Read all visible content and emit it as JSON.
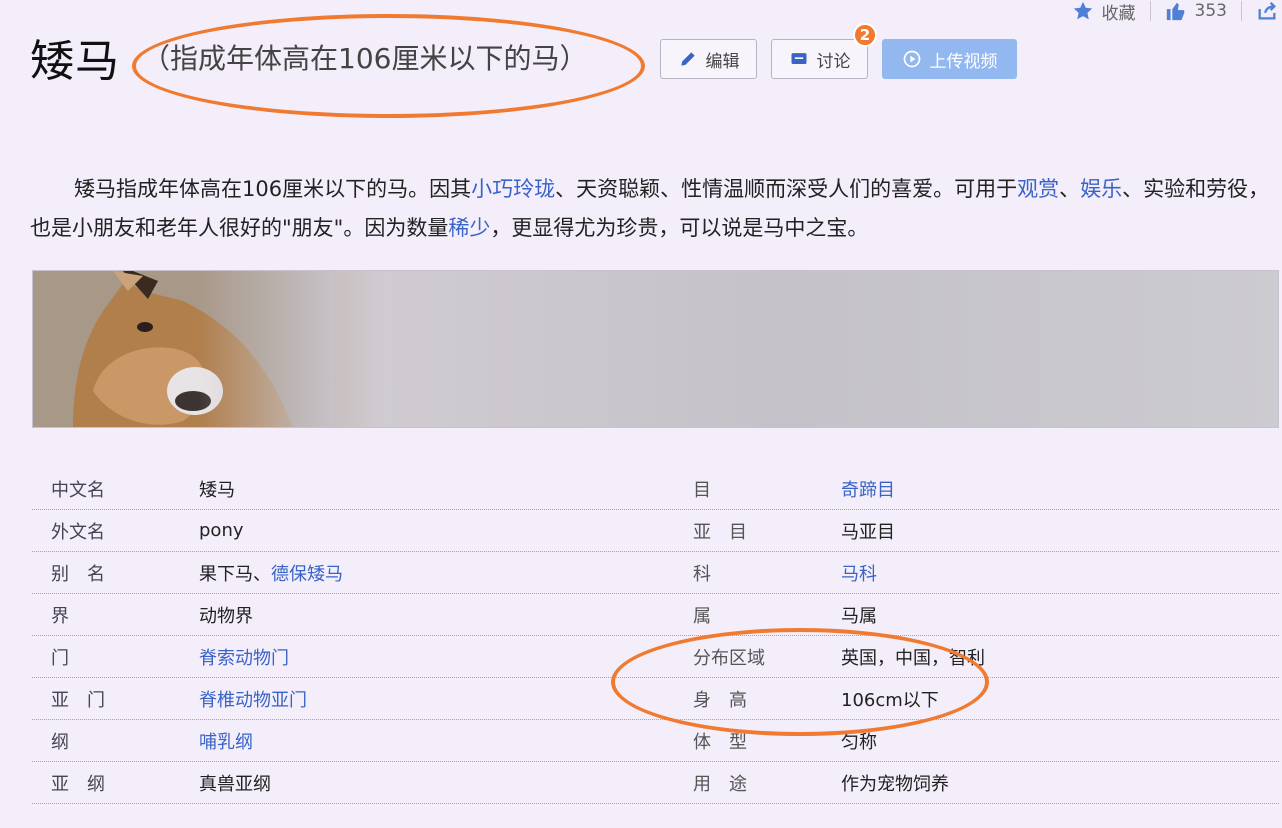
{
  "topbar": {
    "favorite_label": "收藏",
    "like_count": "353"
  },
  "title": {
    "main": "矮马",
    "subtitle": "（指成年体高在106厘米以下的马）"
  },
  "buttons": {
    "edit": "编辑",
    "discuss": "讨论",
    "discuss_badge": "2",
    "upload": "上传视频"
  },
  "intro": {
    "p1": "矮马指成年体高在106厘米以下的马。因其",
    "link_small": "小巧玲珑",
    "p2": "、天资聪颖、性情温顺而深受人们的喜爱。可用于",
    "link_view": "观赏",
    "p3": "、",
    "link_ent": "娱乐",
    "p4": "、实验和劳役，也是小朋友和老年人很好的\"朋友\"。因为数量",
    "link_rare": "稀少",
    "p5": "，更显得尤为珍贵，可以说是马中之宝。"
  },
  "info_left": [
    {
      "key": "中文名",
      "value": "矮马"
    },
    {
      "key": "外文名",
      "value": "pony"
    },
    {
      "key": "别　名",
      "value": "果下马、",
      "link": "德保矮马"
    },
    {
      "key": "界",
      "value": "动物界"
    },
    {
      "key": "门",
      "link": "脊索动物门"
    },
    {
      "key": "亚　门",
      "link": "脊椎动物亚门"
    },
    {
      "key": "纲",
      "link": "哺乳纲"
    },
    {
      "key": "亚　纲",
      "value": "真兽亚纲"
    }
  ],
  "info_right": [
    {
      "key": "目",
      "link": "奇蹄目"
    },
    {
      "key": "亚　目",
      "value": "马亚目"
    },
    {
      "key": "科",
      "link": "马科"
    },
    {
      "key": "属",
      "value": "马属"
    },
    {
      "key": "分布区域",
      "value": "英国，中国，智利"
    },
    {
      "key": "身　高",
      "value": "106cm以下"
    },
    {
      "key": "体　型",
      "value": "匀称"
    },
    {
      "key": "用　途",
      "value": "作为宠物饲养"
    }
  ],
  "colors": {
    "link": "#3a63c7",
    "annotation": "#f07a2f",
    "primary_button": "#93b8ef"
  }
}
